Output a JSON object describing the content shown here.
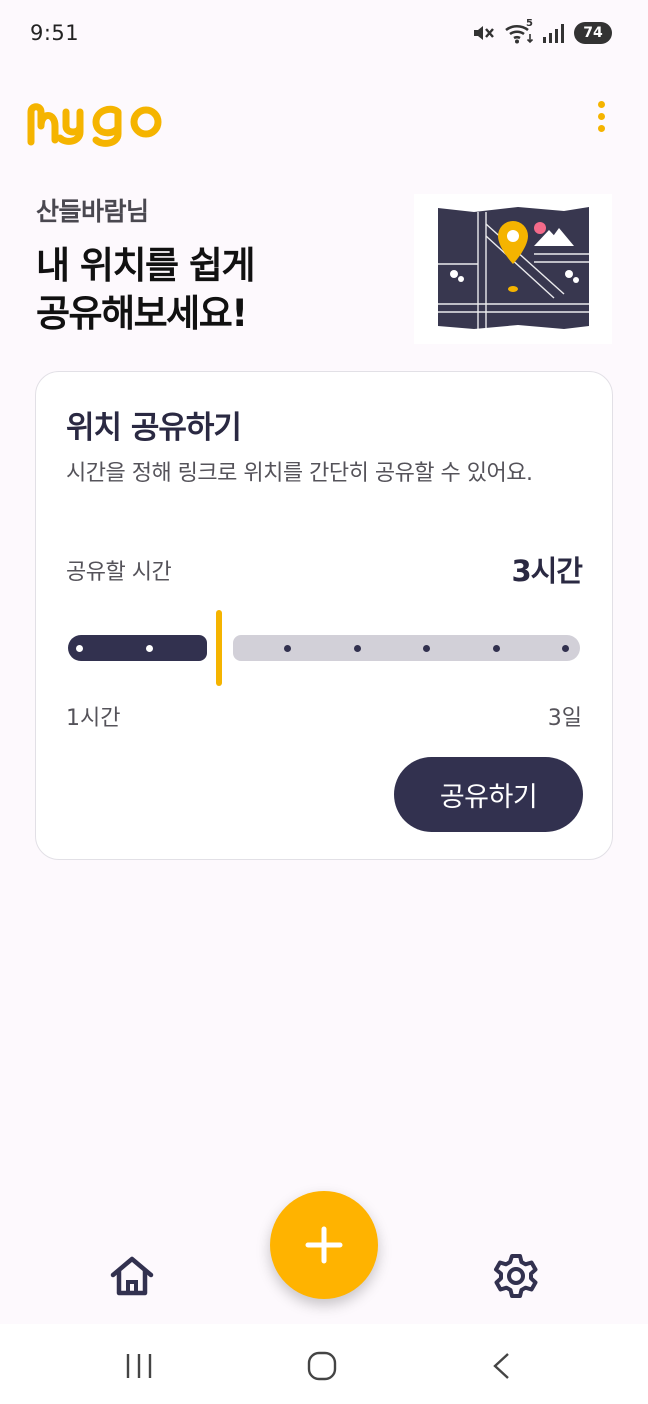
{
  "status_bar": {
    "time": "9:51",
    "battery": "74",
    "wifi_badge": "5",
    "icons": [
      "mute-icon",
      "wifi-icon",
      "signal-icon",
      "battery-icon"
    ]
  },
  "app": {
    "logo_text": "mygo",
    "brand_color": "#f5b400",
    "menu_icon": "more-vert-icon"
  },
  "hero": {
    "user_name": "산들바람님",
    "headline": "내 위치를 쉽게\n공유해보세요!",
    "illustration_icon": "map-pin-icon"
  },
  "share_card": {
    "title": "위치 공유하기",
    "description": "시간을 정해 링크로 위치를 간단히 공유할 수 있어요.",
    "duration_label": "공유할 시간",
    "duration_value": "3시간",
    "slider": {
      "min_label": "1시간",
      "max_label": "3일",
      "steps": 8,
      "selected_index": 2
    },
    "share_button": "공유하기"
  },
  "bottom_nav": {
    "home_icon": "home-icon",
    "add_icon": "plus-icon",
    "settings_icon": "gear-icon"
  },
  "colors": {
    "accent": "#f5b400",
    "navy": "#32314f",
    "track_inactive": "#d2d0d8",
    "background": "#fdf9fd"
  }
}
